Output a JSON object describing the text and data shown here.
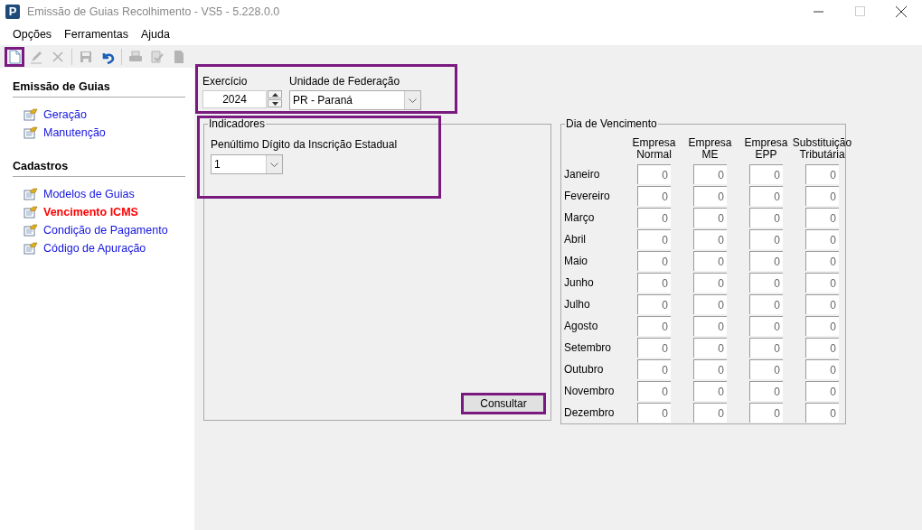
{
  "window": {
    "app_icon": "P",
    "title": "Emissão de Guias Recolhimento - VS5 - 5.228.0.0",
    "maximize_disabled": true
  },
  "menu": [
    {
      "label": "Opções"
    },
    {
      "label": "Ferramentas"
    },
    {
      "label": "Ajuda"
    }
  ],
  "toolbar": [
    {
      "kind": "new",
      "disabled": false,
      "highlighted": true
    },
    {
      "kind": "edit",
      "disabled": true,
      "highlighted": false
    },
    {
      "kind": "delete",
      "disabled": true,
      "highlighted": false
    },
    {
      "kind": "separator"
    },
    {
      "kind": "save",
      "disabled": true,
      "highlighted": false
    },
    {
      "kind": "undo",
      "disabled": false,
      "highlighted": false
    },
    {
      "kind": "separator"
    },
    {
      "kind": "print",
      "disabled": true,
      "highlighted": false
    },
    {
      "kind": "approve",
      "disabled": true,
      "highlighted": false
    },
    {
      "kind": "document",
      "disabled": true,
      "highlighted": false
    }
  ],
  "sidebar": {
    "sections": [
      {
        "title": "Emissão de Guias",
        "items": [
          {
            "label": "Geração",
            "selected": false
          },
          {
            "label": "Manutenção",
            "selected": false
          }
        ]
      },
      {
        "title": "Cadastros",
        "items": [
          {
            "label": "Modelos de Guias",
            "selected": false
          },
          {
            "label": "Vencimento ICMS",
            "selected": true
          },
          {
            "label": "Condição de Pagamento",
            "selected": false
          },
          {
            "label": "Código de Apuração",
            "selected": false
          }
        ]
      }
    ]
  },
  "filters": {
    "highlighted": true,
    "exercicio": {
      "label": "Exercício",
      "value": "2024"
    },
    "uf": {
      "label": "Unidade de Federação",
      "value": "PR - Paraná"
    }
  },
  "indicadores": {
    "title": "Indicadores",
    "highlighted": true,
    "digit": {
      "label": "Penúltimo Dígito da Inscrição Estadual",
      "value": "1"
    }
  },
  "consultar": {
    "label": "Consultar",
    "highlighted": true
  },
  "vencimento": {
    "title": "Dia de Vencimento",
    "columns": [
      "Empresa Normal",
      "Empresa ME",
      "Empresa EPP",
      "Substituição Tributária"
    ],
    "rows": [
      {
        "month": "Janeiro",
        "values": [
          "0",
          "0",
          "0",
          "0"
        ]
      },
      {
        "month": "Fevereiro",
        "values": [
          "0",
          "0",
          "0",
          "0"
        ]
      },
      {
        "month": "Março",
        "values": [
          "0",
          "0",
          "0",
          "0"
        ]
      },
      {
        "month": "Abril",
        "values": [
          "0",
          "0",
          "0",
          "0"
        ]
      },
      {
        "month": "Maio",
        "values": [
          "0",
          "0",
          "0",
          "0"
        ]
      },
      {
        "month": "Junho",
        "values": [
          "0",
          "0",
          "0",
          "0"
        ]
      },
      {
        "month": "Julho",
        "values": [
          "0",
          "0",
          "0",
          "0"
        ]
      },
      {
        "month": "Agosto",
        "values": [
          "0",
          "0",
          "0",
          "0"
        ]
      },
      {
        "month": "Setembro",
        "values": [
          "0",
          "0",
          "0",
          "0"
        ]
      },
      {
        "month": "Outubro",
        "values": [
          "0",
          "0",
          "0",
          "0"
        ]
      },
      {
        "month": "Novembro",
        "values": [
          "0",
          "0",
          "0",
          "0"
        ]
      },
      {
        "month": "Dezembro",
        "values": [
          "0",
          "0",
          "0",
          "0"
        ]
      }
    ]
  }
}
